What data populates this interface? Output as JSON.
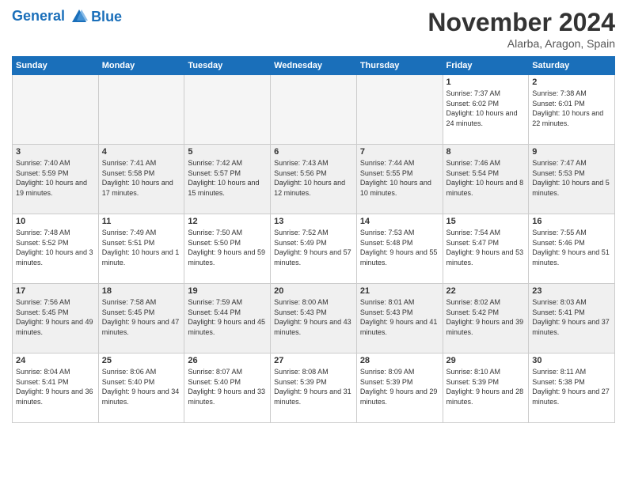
{
  "header": {
    "logo_line1": "General",
    "logo_line2": "Blue",
    "month": "November 2024",
    "location": "Alarba, Aragon, Spain"
  },
  "weekdays": [
    "Sunday",
    "Monday",
    "Tuesday",
    "Wednesday",
    "Thursday",
    "Friday",
    "Saturday"
  ],
  "weeks": [
    [
      {
        "day": "",
        "info": ""
      },
      {
        "day": "",
        "info": ""
      },
      {
        "day": "",
        "info": ""
      },
      {
        "day": "",
        "info": ""
      },
      {
        "day": "",
        "info": ""
      },
      {
        "day": "1",
        "info": "Sunrise: 7:37 AM\nSunset: 6:02 PM\nDaylight: 10 hours and 24 minutes."
      },
      {
        "day": "2",
        "info": "Sunrise: 7:38 AM\nSunset: 6:01 PM\nDaylight: 10 hours and 22 minutes."
      }
    ],
    [
      {
        "day": "3",
        "info": "Sunrise: 7:40 AM\nSunset: 5:59 PM\nDaylight: 10 hours and 19 minutes."
      },
      {
        "day": "4",
        "info": "Sunrise: 7:41 AM\nSunset: 5:58 PM\nDaylight: 10 hours and 17 minutes."
      },
      {
        "day": "5",
        "info": "Sunrise: 7:42 AM\nSunset: 5:57 PM\nDaylight: 10 hours and 15 minutes."
      },
      {
        "day": "6",
        "info": "Sunrise: 7:43 AM\nSunset: 5:56 PM\nDaylight: 10 hours and 12 minutes."
      },
      {
        "day": "7",
        "info": "Sunrise: 7:44 AM\nSunset: 5:55 PM\nDaylight: 10 hours and 10 minutes."
      },
      {
        "day": "8",
        "info": "Sunrise: 7:46 AM\nSunset: 5:54 PM\nDaylight: 10 hours and 8 minutes."
      },
      {
        "day": "9",
        "info": "Sunrise: 7:47 AM\nSunset: 5:53 PM\nDaylight: 10 hours and 5 minutes."
      }
    ],
    [
      {
        "day": "10",
        "info": "Sunrise: 7:48 AM\nSunset: 5:52 PM\nDaylight: 10 hours and 3 minutes."
      },
      {
        "day": "11",
        "info": "Sunrise: 7:49 AM\nSunset: 5:51 PM\nDaylight: 10 hours and 1 minute."
      },
      {
        "day": "12",
        "info": "Sunrise: 7:50 AM\nSunset: 5:50 PM\nDaylight: 9 hours and 59 minutes."
      },
      {
        "day": "13",
        "info": "Sunrise: 7:52 AM\nSunset: 5:49 PM\nDaylight: 9 hours and 57 minutes."
      },
      {
        "day": "14",
        "info": "Sunrise: 7:53 AM\nSunset: 5:48 PM\nDaylight: 9 hours and 55 minutes."
      },
      {
        "day": "15",
        "info": "Sunrise: 7:54 AM\nSunset: 5:47 PM\nDaylight: 9 hours and 53 minutes."
      },
      {
        "day": "16",
        "info": "Sunrise: 7:55 AM\nSunset: 5:46 PM\nDaylight: 9 hours and 51 minutes."
      }
    ],
    [
      {
        "day": "17",
        "info": "Sunrise: 7:56 AM\nSunset: 5:45 PM\nDaylight: 9 hours and 49 minutes."
      },
      {
        "day": "18",
        "info": "Sunrise: 7:58 AM\nSunset: 5:45 PM\nDaylight: 9 hours and 47 minutes."
      },
      {
        "day": "19",
        "info": "Sunrise: 7:59 AM\nSunset: 5:44 PM\nDaylight: 9 hours and 45 minutes."
      },
      {
        "day": "20",
        "info": "Sunrise: 8:00 AM\nSunset: 5:43 PM\nDaylight: 9 hours and 43 minutes."
      },
      {
        "day": "21",
        "info": "Sunrise: 8:01 AM\nSunset: 5:43 PM\nDaylight: 9 hours and 41 minutes."
      },
      {
        "day": "22",
        "info": "Sunrise: 8:02 AM\nSunset: 5:42 PM\nDaylight: 9 hours and 39 minutes."
      },
      {
        "day": "23",
        "info": "Sunrise: 8:03 AM\nSunset: 5:41 PM\nDaylight: 9 hours and 37 minutes."
      }
    ],
    [
      {
        "day": "24",
        "info": "Sunrise: 8:04 AM\nSunset: 5:41 PM\nDaylight: 9 hours and 36 minutes."
      },
      {
        "day": "25",
        "info": "Sunrise: 8:06 AM\nSunset: 5:40 PM\nDaylight: 9 hours and 34 minutes."
      },
      {
        "day": "26",
        "info": "Sunrise: 8:07 AM\nSunset: 5:40 PM\nDaylight: 9 hours and 33 minutes."
      },
      {
        "day": "27",
        "info": "Sunrise: 8:08 AM\nSunset: 5:39 PM\nDaylight: 9 hours and 31 minutes."
      },
      {
        "day": "28",
        "info": "Sunrise: 8:09 AM\nSunset: 5:39 PM\nDaylight: 9 hours and 29 minutes."
      },
      {
        "day": "29",
        "info": "Sunrise: 8:10 AM\nSunset: 5:39 PM\nDaylight: 9 hours and 28 minutes."
      },
      {
        "day": "30",
        "info": "Sunrise: 8:11 AM\nSunset: 5:38 PM\nDaylight: 9 hours and 27 minutes."
      }
    ]
  ]
}
